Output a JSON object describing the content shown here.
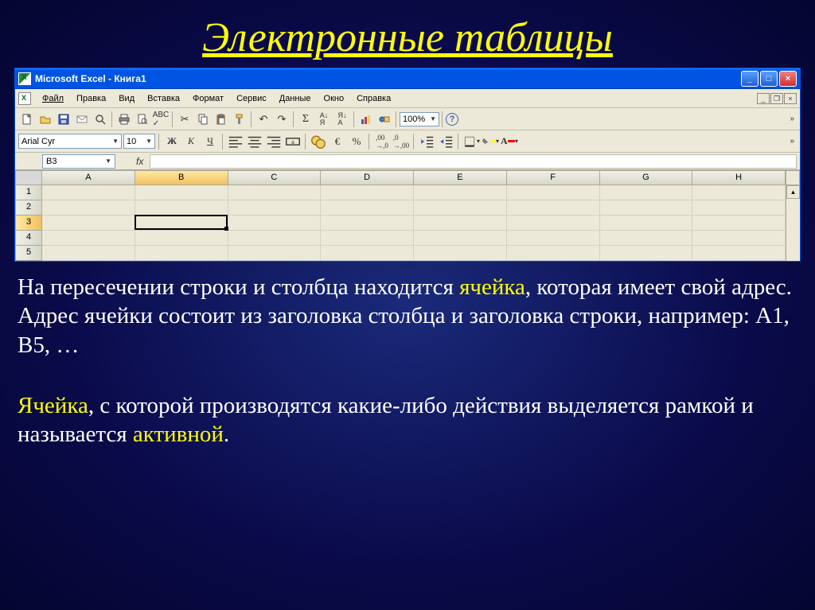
{
  "slide": {
    "title": "Электронные таблицы",
    "para1_a": "На пересечении строки и столбца находится ",
    "para1_hl": "ячейка",
    "para1_b": ", которая имеет свой адрес. Адрес ячейки состоит из заголовка столбца  и заголовка строки, например: А1, В5, …",
    "para2_a": "Ячейка",
    "para2_b": ",  с которой производятся какие-либо действия выделяется рамкой и называется ",
    "para2_hl": "активной",
    "para2_c": "."
  },
  "excel": {
    "title": "Microsoft Excel - Книга1",
    "menus": {
      "file": "Файл",
      "edit": "Правка",
      "view": "Вид",
      "insert": "Вставка",
      "format": "Формат",
      "tools": "Сервис",
      "data": "Данные",
      "window": "Окно",
      "help": "Справка"
    },
    "zoom": "100%",
    "font_name": "Arial Cyr",
    "font_size": "10",
    "namebox": "B3",
    "columns": [
      "A",
      "B",
      "C",
      "D",
      "E",
      "F",
      "G",
      "H"
    ],
    "rows": [
      "1",
      "2",
      "3",
      "4",
      "5"
    ],
    "active": {
      "col": 1,
      "row": 2
    }
  }
}
